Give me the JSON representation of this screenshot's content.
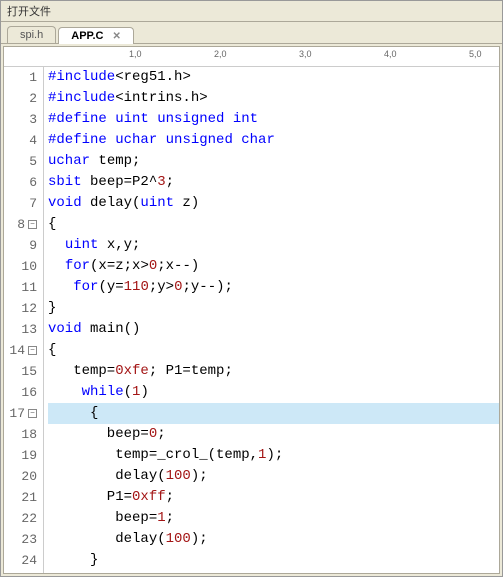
{
  "window": {
    "title": "打开文件"
  },
  "tabs": [
    {
      "label": "spi.h",
      "active": false
    },
    {
      "label": "APP.C",
      "active": true
    }
  ],
  "ruler": [
    "1,0",
    "2,0",
    "3,0",
    "4,0",
    "5,0"
  ],
  "code": {
    "lines": [
      {
        "n": 1,
        "fold": null,
        "hl": false,
        "t": [
          [
            "pp",
            "#include"
          ],
          [
            "op",
            "<"
          ],
          [
            "ppname",
            "reg51.h"
          ],
          [
            "op",
            ">"
          ]
        ]
      },
      {
        "n": 2,
        "fold": null,
        "hl": false,
        "t": [
          [
            "pp",
            "#include"
          ],
          [
            "op",
            "<"
          ],
          [
            "ppname",
            "intrins.h"
          ],
          [
            "op",
            ">"
          ]
        ]
      },
      {
        "n": 3,
        "fold": null,
        "hl": false,
        "t": [
          [
            "pp",
            "#define"
          ],
          [
            "id",
            " "
          ],
          [
            "macro",
            "uint"
          ],
          [
            "id",
            " "
          ],
          [
            "kw",
            "unsigned int"
          ]
        ]
      },
      {
        "n": 4,
        "fold": null,
        "hl": false,
        "t": [
          [
            "pp",
            "#define"
          ],
          [
            "id",
            " "
          ],
          [
            "macro",
            "uchar"
          ],
          [
            "id",
            " "
          ],
          [
            "kw",
            "unsigned char"
          ]
        ]
      },
      {
        "n": 5,
        "fold": null,
        "hl": false,
        "t": [
          [
            "kw",
            "uchar"
          ],
          [
            "id",
            " temp;"
          ]
        ]
      },
      {
        "n": 6,
        "fold": null,
        "hl": false,
        "t": [
          [
            "kw",
            "sbit"
          ],
          [
            "id",
            " beep=P2^"
          ],
          [
            "num",
            "3"
          ],
          [
            "id",
            ";"
          ]
        ]
      },
      {
        "n": 7,
        "fold": null,
        "hl": false,
        "t": [
          [
            "kw",
            "void"
          ],
          [
            "id",
            " delay("
          ],
          [
            "kw",
            "uint"
          ],
          [
            "id",
            " z)"
          ]
        ]
      },
      {
        "n": 8,
        "fold": "minus",
        "hl": false,
        "t": [
          [
            "id",
            "{"
          ]
        ]
      },
      {
        "n": 9,
        "fold": null,
        "hl": false,
        "t": [
          [
            "id",
            "  "
          ],
          [
            "kw",
            "uint"
          ],
          [
            "id",
            " x,y;"
          ]
        ]
      },
      {
        "n": 10,
        "fold": null,
        "hl": false,
        "t": [
          [
            "id",
            "  "
          ],
          [
            "kw",
            "for"
          ],
          [
            "id",
            "(x=z;x>"
          ],
          [
            "num",
            "0"
          ],
          [
            "id",
            ";x--)"
          ]
        ]
      },
      {
        "n": 11,
        "fold": null,
        "hl": false,
        "t": [
          [
            "id",
            "   "
          ],
          [
            "kw",
            "for"
          ],
          [
            "id",
            "(y="
          ],
          [
            "num",
            "110"
          ],
          [
            "id",
            ";y>"
          ],
          [
            "num",
            "0"
          ],
          [
            "id",
            ";y--);"
          ]
        ]
      },
      {
        "n": 12,
        "fold": null,
        "hl": false,
        "t": [
          [
            "id",
            "}"
          ]
        ]
      },
      {
        "n": 13,
        "fold": null,
        "hl": false,
        "t": [
          [
            "kw",
            "void"
          ],
          [
            "id",
            " main()"
          ]
        ]
      },
      {
        "n": 14,
        "fold": "minus",
        "hl": false,
        "t": [
          [
            "id",
            "{"
          ]
        ]
      },
      {
        "n": 15,
        "fold": null,
        "hl": false,
        "t": [
          [
            "id",
            "   temp="
          ],
          [
            "num",
            "0xfe"
          ],
          [
            "id",
            "; P1=temp;"
          ]
        ]
      },
      {
        "n": 16,
        "fold": null,
        "hl": false,
        "t": [
          [
            "id",
            "    "
          ],
          [
            "kw",
            "while"
          ],
          [
            "id",
            "("
          ],
          [
            "num",
            "1"
          ],
          [
            "id",
            ")"
          ]
        ]
      },
      {
        "n": 17,
        "fold": "minus",
        "hl": true,
        "t": [
          [
            "id",
            "     {"
          ]
        ]
      },
      {
        "n": 18,
        "fold": null,
        "hl": false,
        "t": [
          [
            "id",
            "       beep="
          ],
          [
            "num",
            "0"
          ],
          [
            "id",
            ";"
          ]
        ]
      },
      {
        "n": 19,
        "fold": null,
        "hl": false,
        "t": [
          [
            "id",
            "        temp=_crol_(temp,"
          ],
          [
            "num",
            "1"
          ],
          [
            "id",
            ");"
          ]
        ]
      },
      {
        "n": 20,
        "fold": null,
        "hl": false,
        "t": [
          [
            "id",
            "        delay("
          ],
          [
            "num",
            "100"
          ],
          [
            "id",
            ");"
          ]
        ]
      },
      {
        "n": 21,
        "fold": null,
        "hl": false,
        "t": [
          [
            "id",
            "       P1="
          ],
          [
            "num",
            "0xff"
          ],
          [
            "id",
            ";"
          ]
        ]
      },
      {
        "n": 22,
        "fold": null,
        "hl": false,
        "t": [
          [
            "id",
            "        beep="
          ],
          [
            "num",
            "1"
          ],
          [
            "id",
            ";"
          ]
        ]
      },
      {
        "n": 23,
        "fold": null,
        "hl": false,
        "t": [
          [
            "id",
            "        delay("
          ],
          [
            "num",
            "100"
          ],
          [
            "id",
            ");"
          ]
        ]
      },
      {
        "n": 24,
        "fold": null,
        "hl": false,
        "t": [
          [
            "id",
            "     }"
          ]
        ]
      }
    ]
  }
}
